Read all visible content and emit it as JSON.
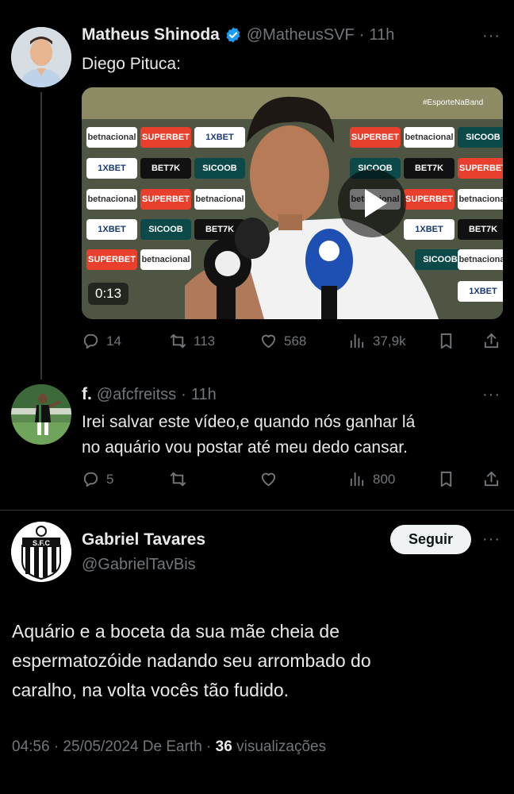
{
  "tweet1": {
    "name": "Matheus Shinoda",
    "handle": "@MatheusSVF",
    "time": "11h",
    "text": "Diego Pituca:",
    "video_duration": "0:13",
    "video_watermark": "#EsporteNaBand",
    "stats": {
      "replies": "14",
      "reposts": "113",
      "likes": "568",
      "views": "37,9k"
    }
  },
  "tweet2": {
    "name": "f.",
    "handle": "@afcfreitss",
    "time": "11h",
    "text_line1": "Irei salvar este vídeo,e quando nós ganhar lá",
    "text_line2": "no aquário vou postar até meu dedo cansar.",
    "stats": {
      "replies": "5",
      "views": "800"
    }
  },
  "tweet3": {
    "name": "Gabriel Tavares",
    "handle": "@GabrielTavBis",
    "follow_label": "Seguir",
    "text_line1": "Aquário e a boceta da sua mãe cheia de",
    "text_line2": "espermatozóide nadando seu arrombado do",
    "text_line3": "caralho, na volta vocês tão fudido.",
    "meta": "04:56 · 25/05/2024 De Earth · ",
    "views_count": "36",
    "views_label": " visualizações"
  },
  "more_label": "···",
  "colors": {
    "background": "#000000",
    "text": "#e7e9ea",
    "muted": "#71767b",
    "verified": "#1d9bf0",
    "follow_bg": "#eff3f4"
  },
  "video_ads": [
    "betnacional",
    "SUPERBET",
    "1XBET",
    "BET7K",
    "SICOOB"
  ]
}
